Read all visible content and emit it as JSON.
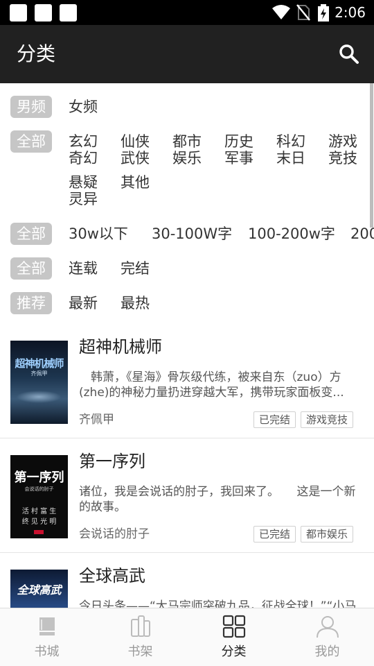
{
  "status_bar": {
    "time": "2:06"
  },
  "header": {
    "title": "分类"
  },
  "filters": {
    "gender": {
      "selected": "男频",
      "options": [
        "女频"
      ]
    },
    "genre": {
      "selected": "全部",
      "options": [
        {
          "line1": "玄幻",
          "line2": "奇幻"
        },
        {
          "line1": "仙侠",
          "line2": "武侠"
        },
        {
          "line1": "都市",
          "line2": "娱乐"
        },
        {
          "line1": "历史",
          "line2": "军事"
        },
        {
          "line1": "科幻",
          "line2": "末日"
        },
        {
          "line1": "游戏",
          "line2": "竞技"
        },
        {
          "line1": "悬疑",
          "line2": "灵异"
        },
        {
          "line1": "其他",
          "line2": ""
        }
      ]
    },
    "word_count": {
      "selected": "全部",
      "options": [
        "30w以下",
        "30-100W字",
        "100-200w字",
        "200"
      ]
    },
    "status": {
      "selected": "全部",
      "options": [
        "连载",
        "完结"
      ]
    },
    "sort": {
      "selected": "推荐",
      "options": [
        "最新",
        "最热"
      ]
    }
  },
  "books": [
    {
      "title": "超神机械师",
      "desc": "　韩萧，《星海》骨灰级代练，被来自东（zuo）方(zhe)的神秘力量扔进穿越大军，携带玩家面板变...",
      "author": "齐佩甲",
      "tags": [
        "已完结",
        "游戏竞技"
      ],
      "cover_text": "超神机械师",
      "cover_author": "齐佩甲"
    },
    {
      "title": "第一序列",
      "desc": "诸位，我是会说话的肘子，我回来了。　　这是一个新的故事。",
      "author": "会说话的肘子",
      "tags": [
        "已完结",
        "都市娱乐"
      ],
      "cover_text": "第一序列",
      "cover_author": "会说话的肘子",
      "cover_sub1": "活 村 富 生",
      "cover_sub2": "终 见 光 明"
    },
    {
      "title": "全球高武",
      "desc": "今日头条——“大马宗师突破九品，征战全球！”“小马",
      "cover_text": "全球高武"
    }
  ],
  "bottom_nav": [
    {
      "label": "书城",
      "icon": "book-icon"
    },
    {
      "label": "书架",
      "icon": "bookshelf-icon"
    },
    {
      "label": "分类",
      "icon": "grid-icon",
      "active": true
    },
    {
      "label": "我的",
      "icon": "person-icon"
    }
  ],
  "colors": {
    "header_bg": "#212121",
    "pill_bg": "#c6c6c6",
    "active_text": "#222222",
    "inactive_text": "#999999"
  }
}
